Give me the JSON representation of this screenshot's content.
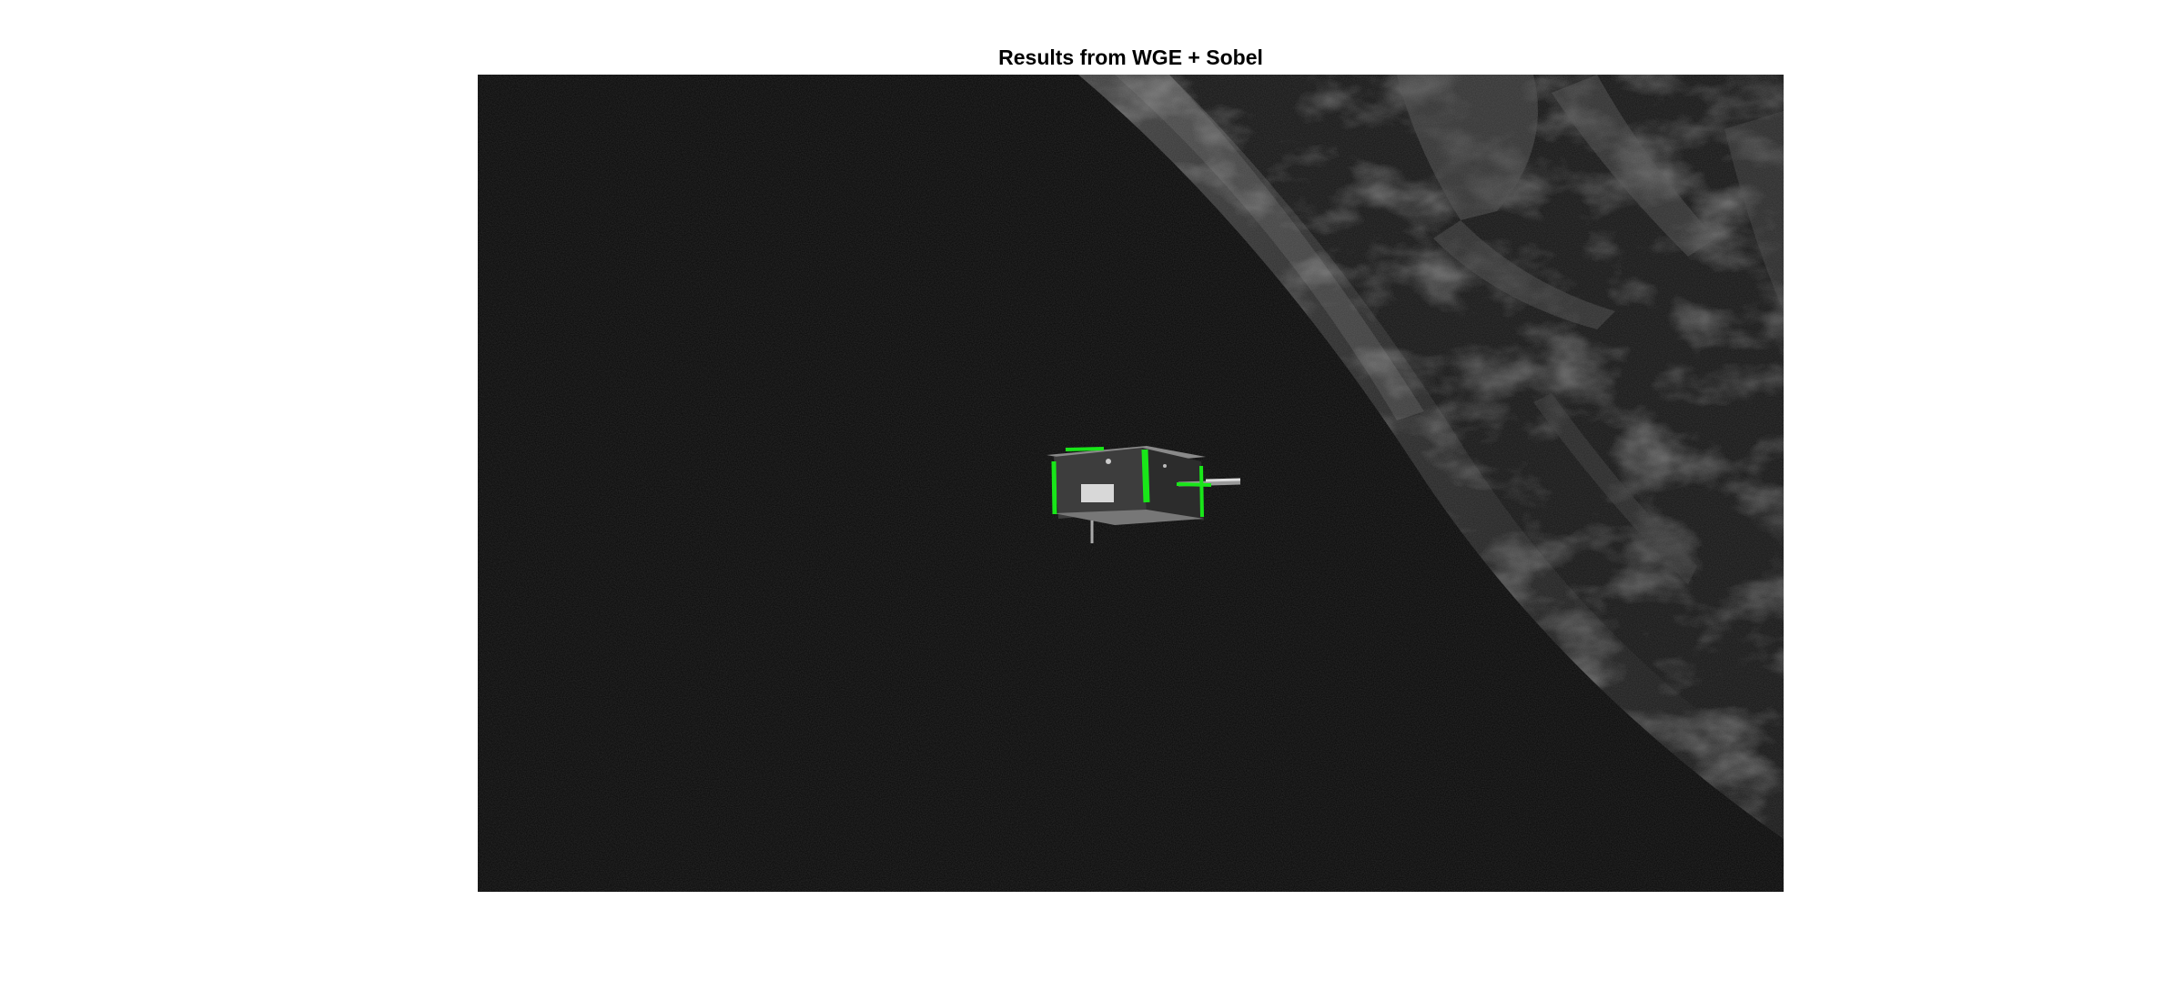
{
  "figure": {
    "title": "Results from WGE + Sobel"
  },
  "colors": {
    "background": "#ffffff",
    "space": "#060606",
    "earth_surface": "#3a3a3a",
    "detected_edges": "#19e619",
    "satellite_body": "#4a4a4a"
  }
}
